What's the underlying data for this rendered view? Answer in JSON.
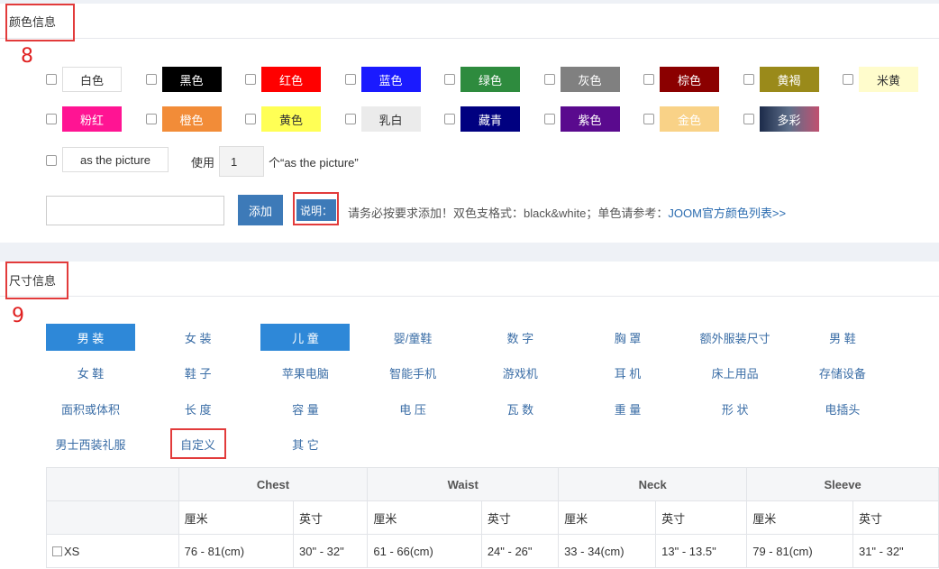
{
  "color_section": {
    "title": "颜色信息",
    "annotation_number": "8",
    "colors": [
      {
        "label": "白色",
        "bg": "#ffffff",
        "fg": "#333333"
      },
      {
        "label": "黑色",
        "bg": "#000000",
        "fg": "#ffffff"
      },
      {
        "label": "红色",
        "bg": "#ff0000",
        "fg": "#ffffff"
      },
      {
        "label": "蓝色",
        "bg": "#1a1aff",
        "fg": "#ffffff"
      },
      {
        "label": "绿色",
        "bg": "#2e8b3e",
        "fg": "#ffffff"
      },
      {
        "label": "灰色",
        "bg": "#808080",
        "fg": "#ffffff"
      },
      {
        "label": "棕色",
        "bg": "#8b0000",
        "fg": "#ffffff"
      },
      {
        "label": "黄褐",
        "bg": "#9a8a1a",
        "fg": "#ffffff"
      },
      {
        "label": "米黄",
        "bg": "#fffccc",
        "fg": "#333333"
      },
      {
        "label": "粉红",
        "bg": "#ff1493",
        "fg": "#ffffff"
      },
      {
        "label": "橙色",
        "bg": "#f28c38",
        "fg": "#ffffff"
      },
      {
        "label": "黄色",
        "bg": "#ffff55",
        "fg": "#333333"
      },
      {
        "label": "乳白",
        "bg": "#ebebeb",
        "fg": "#333333"
      },
      {
        "label": "藏青",
        "bg": "#000080",
        "fg": "#ffffff"
      },
      {
        "label": "紫色",
        "bg": "#5a0a8e",
        "fg": "#ffffff"
      },
      {
        "label": "金色",
        "bg": "#f9d287",
        "fg": "#ffffff"
      },
      {
        "label": "多彩",
        "bg": "linear-gradient(90deg,#1c2b4a,#5e6f8a,#c05070)",
        "fg": "#ffffff"
      }
    ],
    "as_picture_label": "as the picture",
    "use_label": "使用",
    "use_count": "1",
    "unit_suffix": "个“as the picture”",
    "custom_input_value": "",
    "add_button": "添加",
    "note_label": "说明：",
    "note_text": "请务必按要求添加！双色支格式：black&white；单色请参考：",
    "note_link": "JOOM官方颜色列表>>"
  },
  "size_section": {
    "title": "尺寸信息",
    "annotation_number": "9",
    "categories": [
      {
        "label": "男 装",
        "active": true
      },
      {
        "label": "女 装",
        "active": false
      },
      {
        "label": "儿 童",
        "active": true
      },
      {
        "label": "婴/童鞋",
        "active": false
      },
      {
        "label": "数 字",
        "active": false
      },
      {
        "label": "胸 罩",
        "active": false
      },
      {
        "label": "额外服装尺寸",
        "active": false
      },
      {
        "label": "男 鞋",
        "active": false
      },
      {
        "label": "女 鞋",
        "active": false
      },
      {
        "label": "鞋 子",
        "active": false
      },
      {
        "label": "苹果电脑",
        "active": false
      },
      {
        "label": "智能手机",
        "active": false
      },
      {
        "label": "游戏机",
        "active": false
      },
      {
        "label": "耳 机",
        "active": false
      },
      {
        "label": "床上用品",
        "active": false
      },
      {
        "label": "存储设备",
        "active": false
      },
      {
        "label": "面积或体积",
        "active": false
      },
      {
        "label": "长 度",
        "active": false
      },
      {
        "label": "容 量",
        "active": false
      },
      {
        "label": "电 压",
        "active": false
      },
      {
        "label": "瓦 数",
        "active": false
      },
      {
        "label": "重 量",
        "active": false
      },
      {
        "label": "形 状",
        "active": false
      },
      {
        "label": "电插头",
        "active": false
      },
      {
        "label": "男士西装礼服",
        "active": false
      },
      {
        "label": "自定义",
        "active": false
      },
      {
        "label": "其 它",
        "active": false
      }
    ],
    "table": {
      "groups": [
        "Chest",
        "Waist",
        "Neck",
        "Sleeve"
      ],
      "units": [
        "厘米",
        "英寸",
        "厘米",
        "英寸",
        "厘米",
        "英寸",
        "厘米",
        "英寸"
      ],
      "rows": [
        {
          "size": "XS",
          "values": [
            "76 - 81(cm)",
            "30\" - 32\"",
            "61 - 66(cm)",
            "24\" - 26\"",
            "33 - 34(cm)",
            "13\" - 13.5\"",
            "79 - 81(cm)",
            "31\" - 32\""
          ]
        }
      ]
    }
  }
}
